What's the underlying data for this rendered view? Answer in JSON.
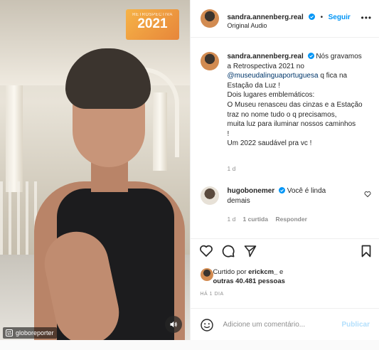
{
  "media": {
    "badge_small": "RETROSPECTIVA",
    "badge_year": "2021",
    "repost_user": "globoreporter"
  },
  "header": {
    "username": "sandra.annenberg.real",
    "separator": "•",
    "follow_label": "Seguir",
    "audio_label": "Original Audio",
    "more": "•••"
  },
  "caption": {
    "username": "sandra.annenberg.real",
    "lines": [
      "Nós gravamos",
      "a Retrospectiva 2021 no",
      "q fica na",
      "Estação da Luz !",
      "Dois lugares emblemáticos:",
      "O Museu renasceu das cinzas e a Estação",
      "traz no nome tudo o q precisamos,",
      "muita luz para iluminar nossos caminhos",
      "!",
      "Um 2022 saudável pra vc !"
    ],
    "mention": "@museudalinguaportuguesa",
    "age": "1 d"
  },
  "comment": {
    "username": "hugobonemer",
    "text": "Você é linda",
    "text2": "demais",
    "age": "1 d",
    "likes": "1 curtida",
    "reply": "Responder"
  },
  "likes": {
    "prefix": "Curtido por",
    "user": "erickcm_",
    "conj": "e",
    "others": "outras 40.481 pessoas"
  },
  "time_ago": "HÁ 1 DIA",
  "comment_box": {
    "placeholder": "Adicione um comentário...",
    "publish": "Publicar"
  },
  "colors": {
    "accent": "#0095f6",
    "publish_disabled": "#b2dffc",
    "meta": "#8e8e8e"
  }
}
